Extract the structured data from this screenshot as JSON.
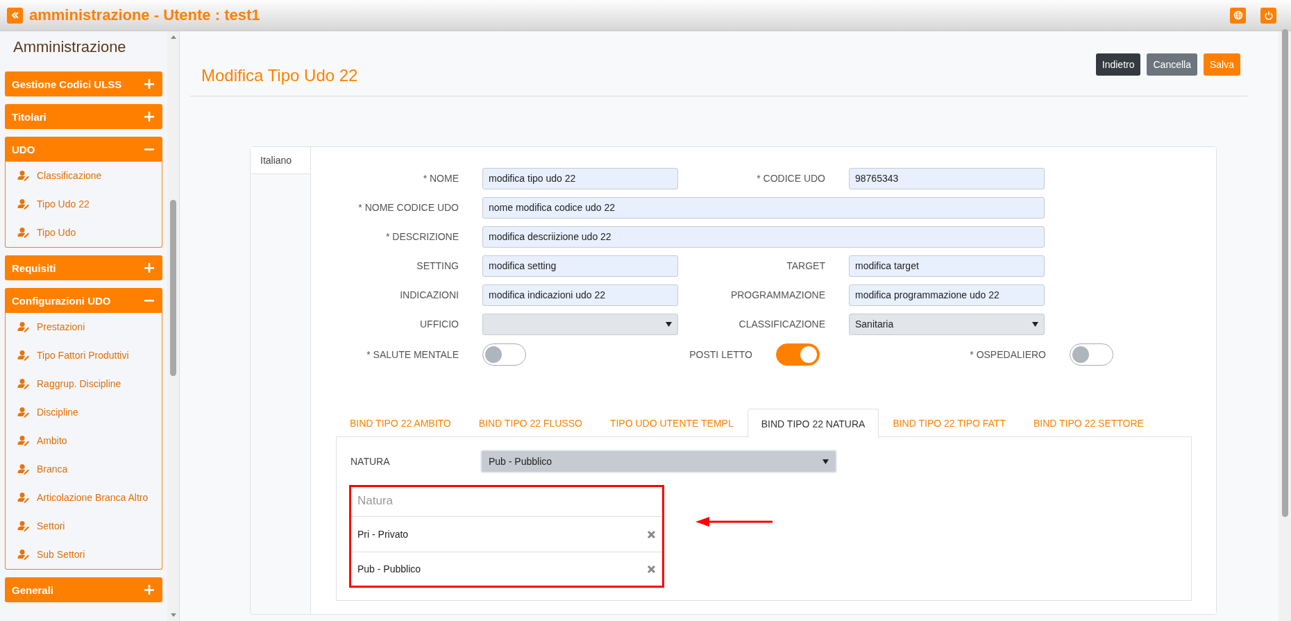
{
  "app_bar": {
    "title": "amministrazione - Utente : test1"
  },
  "sidebar": {
    "title": "Amministrazione",
    "sections": [
      {
        "label": "Gestione Codici ULSS",
        "expanded": false
      },
      {
        "label": "Titolari",
        "expanded": false
      },
      {
        "label": "UDO",
        "expanded": true,
        "items": [
          "Classificazione",
          "Tipo Udo 22",
          "Tipo Udo"
        ]
      },
      {
        "label": "Requisiti",
        "expanded": false
      },
      {
        "label": "Configurazioni UDO",
        "expanded": true,
        "items": [
          "Prestazioni",
          "Tipo Fattori Produttivi",
          "Raggrup. Discipline",
          "Discipline",
          "Ambito",
          "Branca",
          "Articolazione Branca Altro",
          "Settori",
          "Sub Settori"
        ]
      },
      {
        "label": "Generali",
        "expanded": false
      }
    ]
  },
  "page": {
    "title": "Modifica Tipo Udo 22",
    "buttons": [
      {
        "label": "Indietro",
        "kind": "dark"
      },
      {
        "label": "Cancella",
        "kind": "secondary"
      },
      {
        "label": "Salva",
        "kind": "primary"
      }
    ]
  },
  "language_tabs": [
    {
      "label": "Italiano",
      "selected": true
    }
  ],
  "form": {
    "rows": [
      {
        "kind": "fields",
        "fields": [
          {
            "label": "* NOME",
            "kind": "text",
            "value": "modifica tipo udo 22"
          },
          {
            "label": "* CODICE UDO",
            "kind": "text",
            "value": "98765343"
          }
        ]
      },
      {
        "kind": "fields",
        "fields": [
          {
            "label": "* NOME CODICE UDO",
            "kind": "text",
            "value": "nome modifica codice udo 22"
          }
        ]
      },
      {
        "kind": "fields",
        "fields": [
          {
            "label": "* DESCRIZIONE",
            "kind": "text",
            "value": "modifica descriizione udo 22"
          }
        ]
      },
      {
        "kind": "fields",
        "fields": [
          {
            "label": "SETTING",
            "kind": "text",
            "value": "modifica setting"
          },
          {
            "label": "TARGET",
            "kind": "text",
            "value": "modifica target"
          }
        ]
      },
      {
        "kind": "fields",
        "fields": [
          {
            "label": "INDICAZIONI",
            "kind": "text",
            "value": "modifica indicazioni udo 22"
          },
          {
            "label": "PROGRAMMAZIONE",
            "kind": "text",
            "value": "modifica programmazione udo 22"
          }
        ]
      },
      {
        "kind": "fields",
        "fields": [
          {
            "label": "UFFICIO",
            "kind": "select"
          },
          {
            "label": "CLASSIFICAZIONE",
            "kind": "select",
            "value": "Sanitaria"
          }
        ]
      },
      {
        "kind": "toggles",
        "fields": [
          {
            "label": "* SALUTE MENTALE",
            "kind": "toggle",
            "on": false
          },
          {
            "label": "POSTI LETTO",
            "kind": "toggle",
            "on": true
          },
          {
            "label": "* OSPEDALIERO",
            "kind": "toggle",
            "on": false
          }
        ]
      }
    ]
  },
  "bind_tabs": [
    {
      "label": "BIND TIPO 22 AMBITO",
      "selected": false
    },
    {
      "label": "BIND TIPO 22 FLUSSO",
      "selected": false
    },
    {
      "label": "TIPO UDO UTENTE TEMPL",
      "selected": false
    },
    {
      "label": "BIND TIPO 22 NATURA",
      "selected": true
    },
    {
      "label": "BIND TIPO 22 TIPO FATT",
      "selected": false
    },
    {
      "label": "BIND TIPO 22 SETTORE",
      "selected": false
    }
  ],
  "natura": {
    "label": "NATURA",
    "value": "Pub - Pubblico",
    "list_header": "Natura",
    "items": [
      "Pri - Privato",
      "Pub - Pubblico"
    ]
  }
}
